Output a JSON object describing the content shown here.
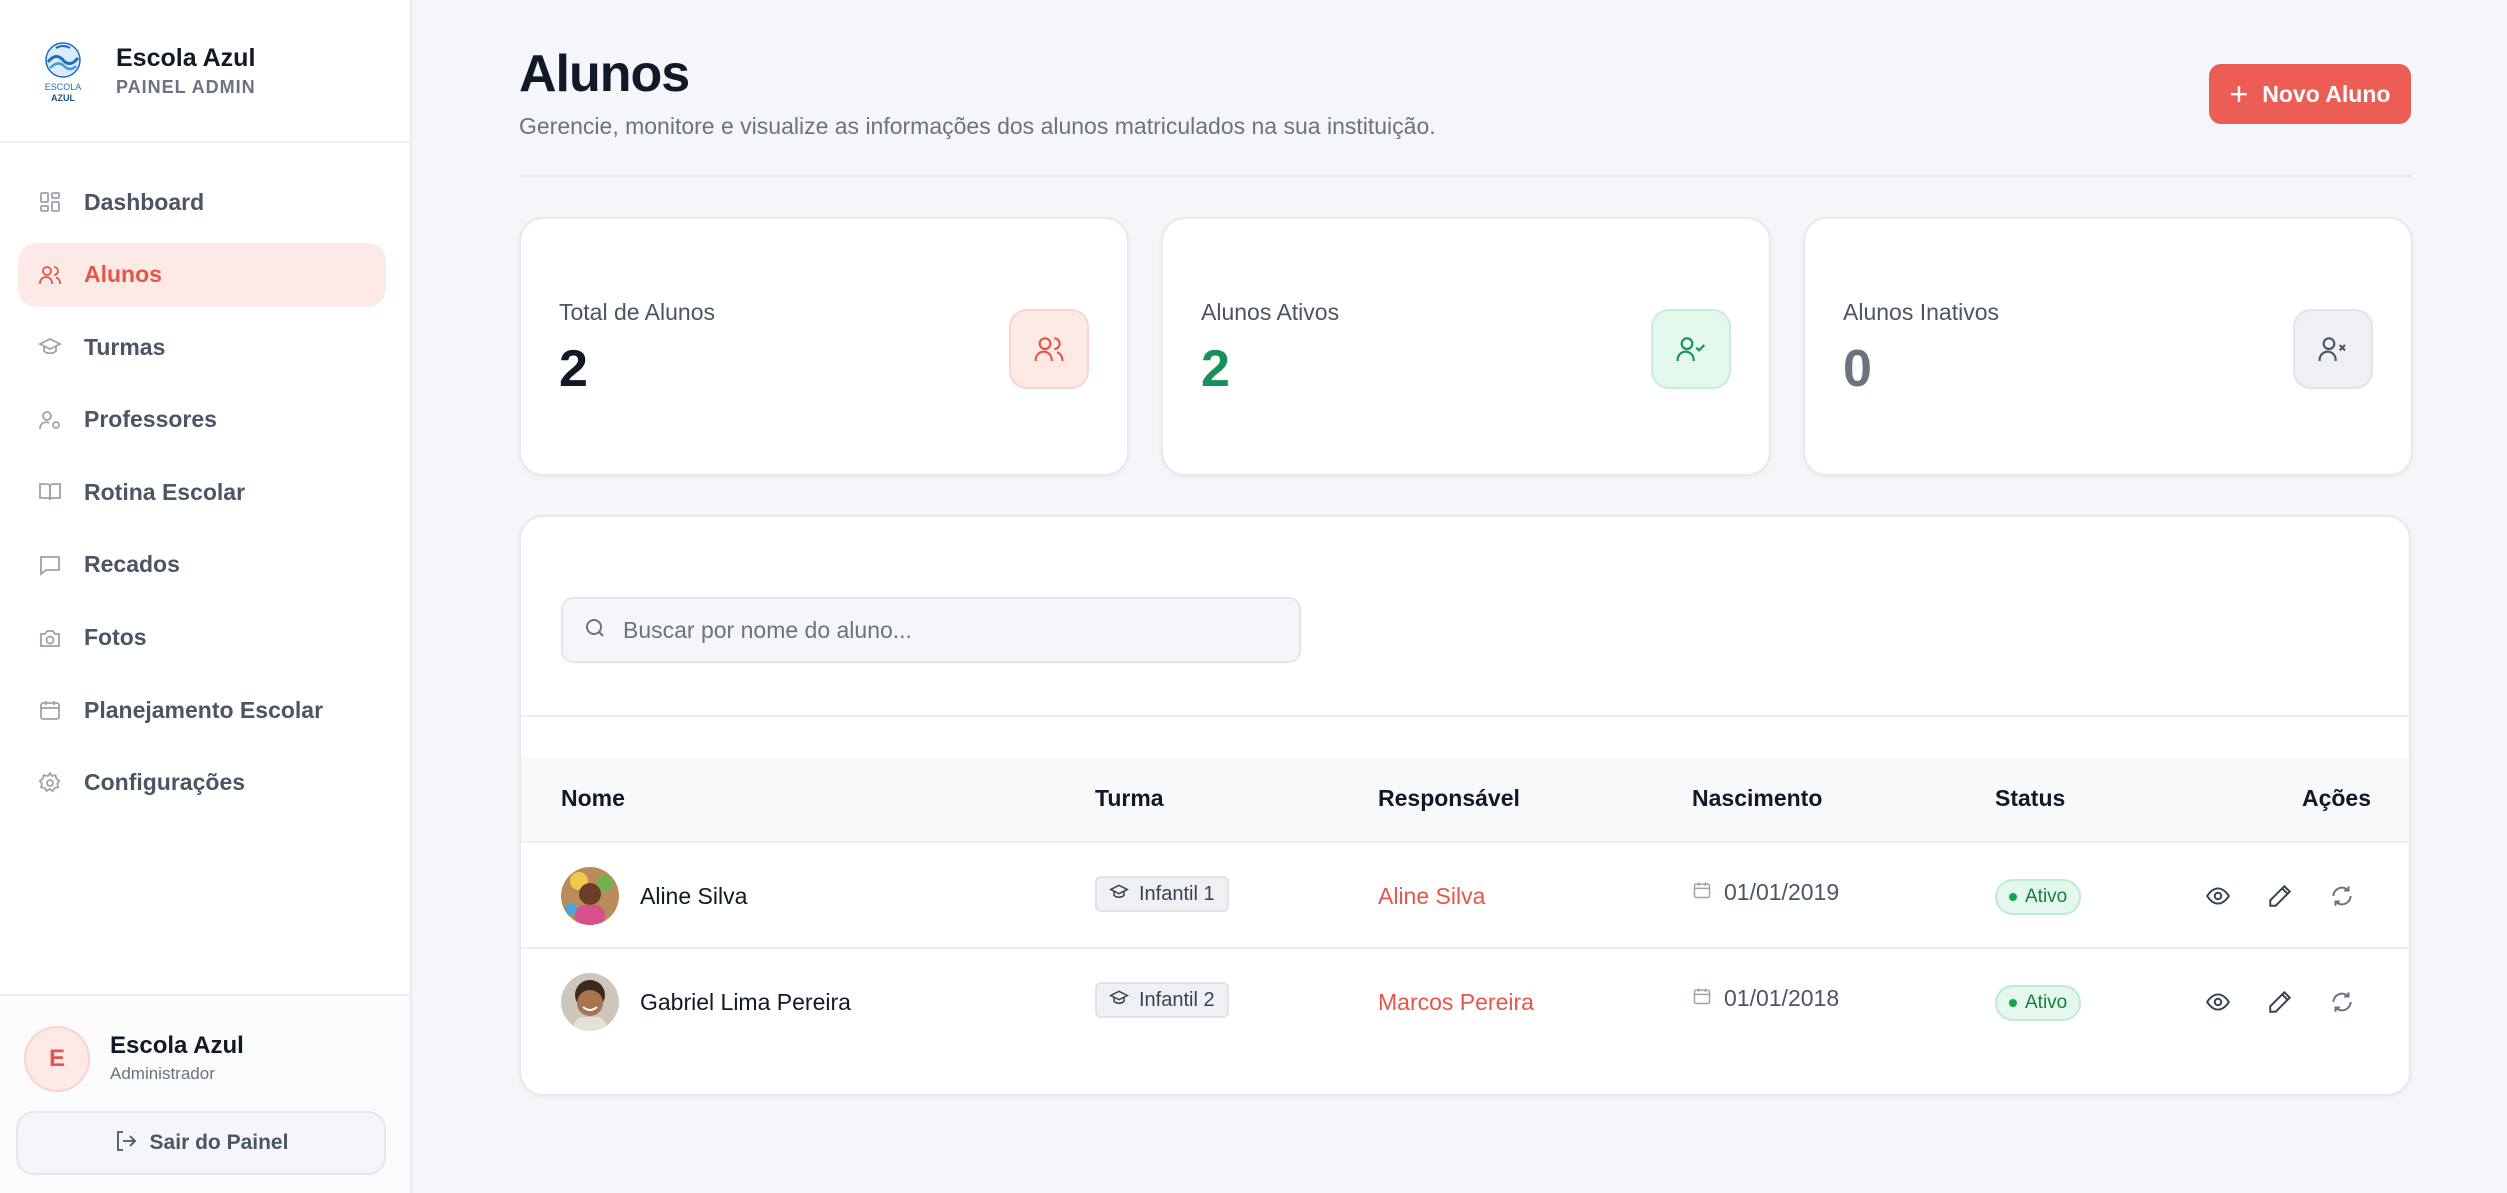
{
  "brand": {
    "name": "Escola Azul",
    "subtitle": "PAINEL ADMIN",
    "logo_text_top": "ESCOLA",
    "logo_text_bottom": "AZUL"
  },
  "sidebar": {
    "items": [
      {
        "label": "Dashboard",
        "icon": "dashboard-icon",
        "active": false
      },
      {
        "label": "Alunos",
        "icon": "users-icon",
        "active": true
      },
      {
        "label": "Turmas",
        "icon": "graduation-cap-icon",
        "active": false
      },
      {
        "label": "Professores",
        "icon": "user-cog-icon",
        "active": false
      },
      {
        "label": "Rotina Escolar",
        "icon": "book-icon",
        "active": false
      },
      {
        "label": "Recados",
        "icon": "message-icon",
        "active": false
      },
      {
        "label": "Fotos",
        "icon": "camera-icon",
        "active": false
      },
      {
        "label": "Planejamento Escolar",
        "icon": "calendar-icon",
        "active": false
      },
      {
        "label": "Configurações",
        "icon": "gear-icon",
        "active": false
      }
    ]
  },
  "user": {
    "initial": "E",
    "name": "Escola Azul",
    "role": "Administrador",
    "logout_label": "Sair do Painel"
  },
  "header": {
    "title": "Alunos",
    "subtitle": "Gerencie, monitore e visualize as informações dos alunos matriculados na sua instituição.",
    "new_button_label": "Novo Aluno"
  },
  "stats": [
    {
      "label": "Total de Alunos",
      "value": "2",
      "color": "#111827",
      "icon": "users-icon"
    },
    {
      "label": "Alunos Ativos",
      "value": "2",
      "color": "#16915a",
      "icon": "user-check-icon"
    },
    {
      "label": "Alunos Inativos",
      "value": "0",
      "color": "#6b7280",
      "icon": "user-x-icon"
    }
  ],
  "search": {
    "placeholder": "Buscar por nome do aluno...",
    "value": ""
  },
  "table": {
    "headers": {
      "nome": "Nome",
      "turma": "Turma",
      "responsavel": "Responsável",
      "nascimento": "Nascimento",
      "status": "Status",
      "acoes": "Ações"
    },
    "rows": [
      {
        "name": "Aline Silva",
        "turma": "Infantil 1",
        "responsavel": "Aline Silva",
        "nascimento": "01/01/2019",
        "status": "Ativo"
      },
      {
        "name": "Gabriel Lima Pereira",
        "turma": "Infantil 2",
        "responsavel": "Marcos Pereira",
        "nascimento": "01/01/2018",
        "status": "Ativo"
      }
    ]
  },
  "colors": {
    "accent": "#ec5e55",
    "active_bg": "#fde9e6",
    "success": "#16915a"
  }
}
